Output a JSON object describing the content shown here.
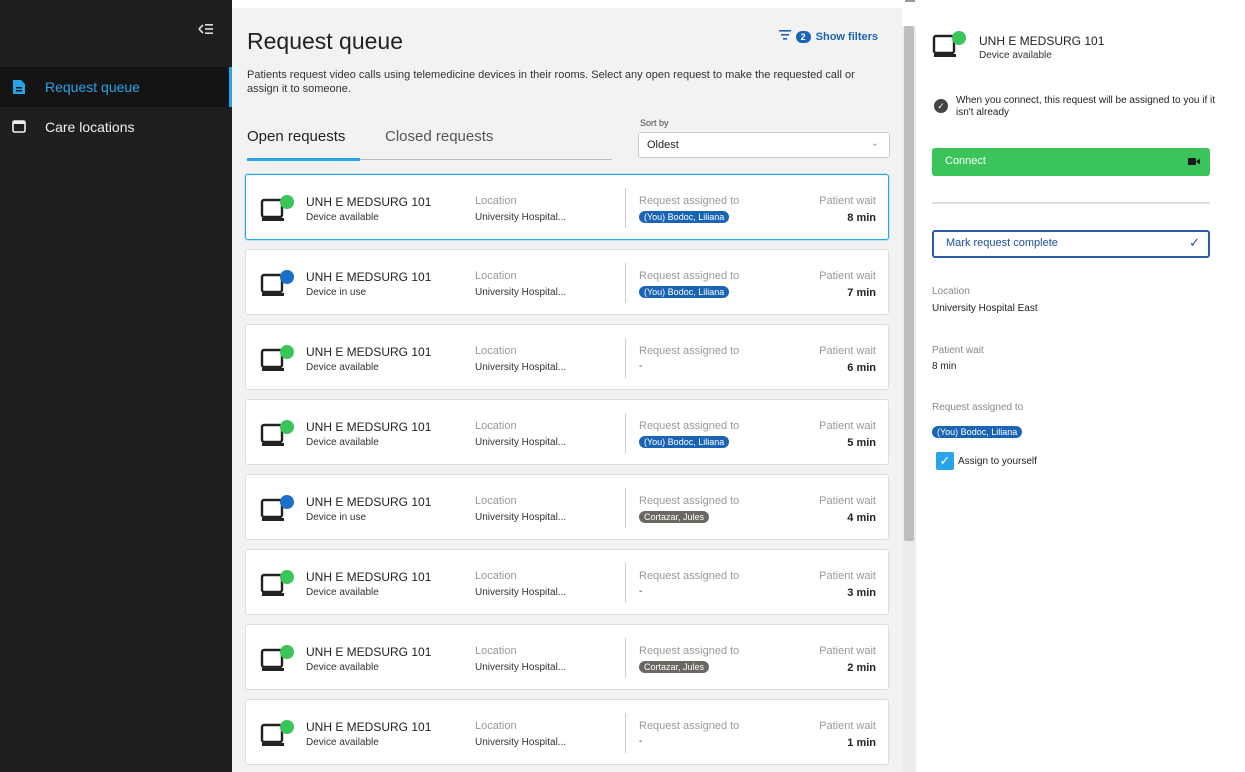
{
  "sidebar": {
    "collapse_icon": "collapse-left-icon",
    "items": [
      {
        "label": "Request queue",
        "icon": "document-icon",
        "active": true
      },
      {
        "label": "Care locations",
        "icon": "calendar-icon",
        "active": false
      }
    ]
  },
  "main": {
    "title": "Request queue",
    "filters_count": "2",
    "filters_label": "Show filters",
    "description": "Patients request video calls using telemedicine devices in their rooms. Select any open request to make the requested call or assign it to someone.",
    "tabs": [
      {
        "label": "Open requests",
        "active": true
      },
      {
        "label": "Closed requests",
        "active": false
      }
    ],
    "sort_label": "Sort by",
    "sort_value": "Oldest",
    "column_labels": {
      "location": "Location",
      "assigned": "Request assigned to",
      "wait": "Patient wait"
    },
    "requests": [
      {
        "room": "UNH E MEDSURG 101",
        "status": "Device available",
        "status_color": "#3ac45a",
        "location": "University Hospital...",
        "assigned": "(You) Bodoc, Liliana",
        "assigned_type": "blue",
        "wait": "8 min",
        "selected": true
      },
      {
        "room": "UNH E MEDSURG 101",
        "status": "Device in use",
        "status_color": "#1a6fc8",
        "location": "University Hospital...",
        "assigned": "(You) Bodoc, Liliana",
        "assigned_type": "blue",
        "wait": "7 min",
        "selected": false
      },
      {
        "room": "UNH E MEDSURG 101",
        "status": "Device available",
        "status_color": "#3ac45a",
        "location": "University Hospital...",
        "assigned": "-",
        "assigned_type": "none",
        "wait": "6 min",
        "selected": false
      },
      {
        "room": "UNH E MEDSURG 101",
        "status": "Device available",
        "status_color": "#3ac45a",
        "location": "University Hospital...",
        "assigned": "(You) Bodoc, Liliana",
        "assigned_type": "blue",
        "wait": "5 min",
        "selected": false
      },
      {
        "room": "UNH E MEDSURG 101",
        "status": "Device in use",
        "status_color": "#1a6fc8",
        "location": "University Hospital...",
        "assigned": "Cortazar, Jules",
        "assigned_type": "gray",
        "wait": "4 min",
        "selected": false
      },
      {
        "room": "UNH E MEDSURG 101",
        "status": "Device available",
        "status_color": "#3ac45a",
        "location": "University Hospital...",
        "assigned": "-",
        "assigned_type": "none",
        "wait": "3 min",
        "selected": false
      },
      {
        "room": "UNH E MEDSURG 101",
        "status": "Device available",
        "status_color": "#3ac45a",
        "location": "University Hospital...",
        "assigned": "Cortazar, Jules",
        "assigned_type": "gray",
        "wait": "2 min",
        "selected": false
      },
      {
        "room": "UNH E MEDSURG 101",
        "status": "Device available",
        "status_color": "#3ac45a",
        "location": "University Hospital...",
        "assigned": "-",
        "assigned_type": "none",
        "wait": "1 min",
        "selected": false
      }
    ]
  },
  "detail": {
    "room": "UNH E MEDSURG 101",
    "status": "Device available",
    "status_color": "#3ac45a",
    "info": "When you connect, this request will be assigned to you if it isn't already",
    "connect_label": "Connect",
    "complete_label": "Mark request complete",
    "location_label": "Location",
    "location_value": "University Hospital East",
    "wait_label": "Patient wait",
    "wait_value": "8 min",
    "assigned_label": "Request assigned to",
    "assigned_value": "(You) Bodoc, Liliana",
    "assign_self_label": "Assign to yourself",
    "assign_self_checked": true
  },
  "colors": {
    "accent": "#2aa4e8",
    "connect": "#3ac45a",
    "chip_blue": "#1a64b5",
    "chip_gray": "#6b6762"
  }
}
